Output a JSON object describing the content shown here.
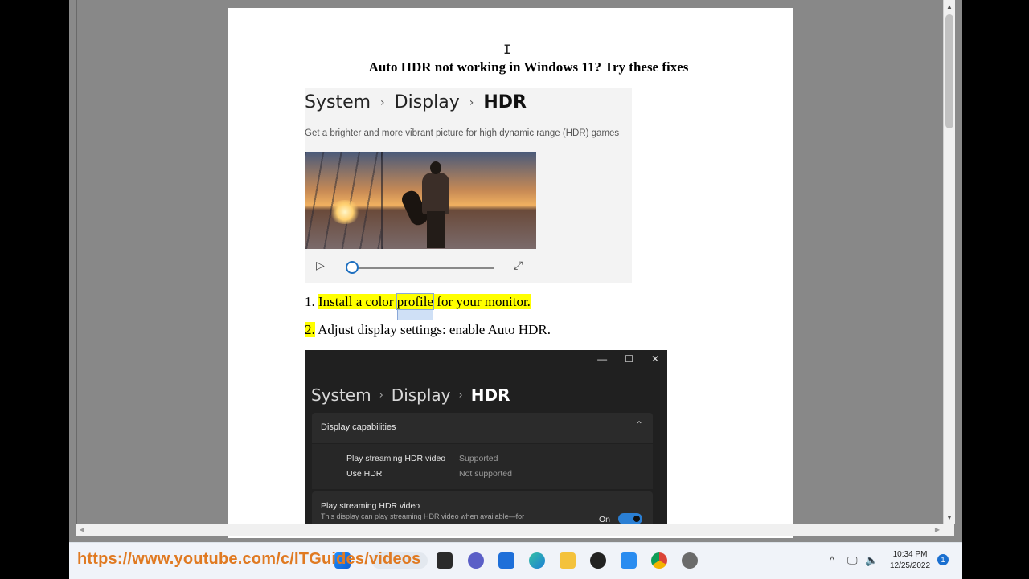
{
  "article": {
    "title": "Auto HDR not working in Windows 11? Try these fixes",
    "step1_num": "1.",
    "step1_pre": "Install a color",
    "step1_sel": "profile",
    "step1_post": "for your monitor.",
    "step2_num": "2.",
    "step2_text": "Adjust display settings: enable Auto HDR."
  },
  "shot1": {
    "crumb1": "System",
    "crumb2": "Display",
    "crumb3": "HDR",
    "sep": "›",
    "description": "Get a brighter and more vibrant picture for high dynamic range (HDR) games",
    "play_icon": "▷",
    "expand_icon": "⤢"
  },
  "shot2": {
    "crumb1": "System",
    "crumb2": "Display",
    "crumb3": "HDR",
    "sep": "›",
    "win_minimize": "—",
    "win_maximize": "☐",
    "win_close": "✕",
    "section_title": "Display capabilities",
    "chevron": "⌃",
    "rows": [
      {
        "label": "Play streaming HDR video",
        "value": "Supported"
      },
      {
        "label": "Use HDR",
        "value": "Not supported"
      }
    ],
    "streaming_title": "Play streaming HDR video",
    "streaming_desc": "This display can play streaming HDR video when available—for",
    "toggle_label": "On"
  },
  "scrollbars": {
    "up": "▲",
    "down": "▼",
    "left": "◀",
    "right": "▶"
  },
  "overlay_url": "https://www.youtube.com/c/ITGuides/videos",
  "taskbar": {
    "tray_chevron": "^",
    "tray_network": "🖵",
    "tray_volume": "🔈",
    "time": "10:34 PM",
    "date": "12/25/2022",
    "notifications": "1"
  }
}
